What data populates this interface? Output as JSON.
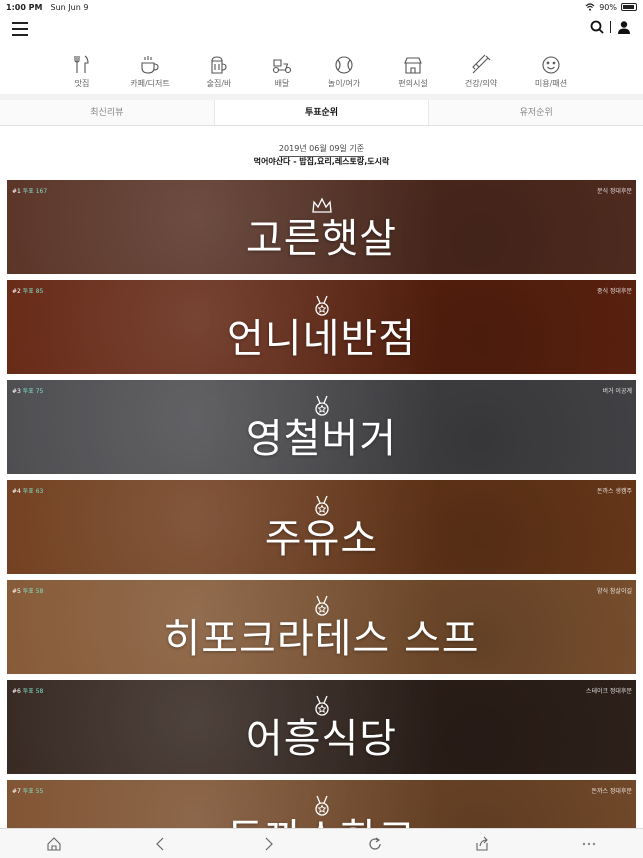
{
  "status": {
    "time": "1:00 PM",
    "date": "Sun Jun 9",
    "battery": "90%",
    "battery_level": 0.9
  },
  "categories": [
    {
      "label": "맛집",
      "icon": "utensils-icon"
    },
    {
      "label": "카페/디저트",
      "icon": "coffee-cup-icon"
    },
    {
      "label": "술집/바",
      "icon": "beer-mug-icon"
    },
    {
      "label": "배달",
      "icon": "delivery-scooter-icon"
    },
    {
      "label": "놀이/여가",
      "icon": "ball-icon"
    },
    {
      "label": "편의시설",
      "icon": "store-icon"
    },
    {
      "label": "건강/의약",
      "icon": "syringe-icon"
    },
    {
      "label": "미용/패션",
      "icon": "smile-face-icon"
    }
  ],
  "tabs": [
    {
      "label": "최신리뷰",
      "active": false
    },
    {
      "label": "투표순위",
      "active": true
    },
    {
      "label": "유저순위",
      "active": false
    }
  ],
  "ranking": {
    "date": "2019년 06월 09일 기준",
    "subtitle": "먹어야산다 - 밥집,요리,레스토랑,도시락",
    "items": [
      {
        "rank": "1",
        "votes": "투표 167",
        "category": "분식 정대후문",
        "name": "고른햇살",
        "medal": "crown-icon",
        "bg": "#6b3a2a"
      },
      {
        "rank": "2",
        "votes": "투표 85",
        "category": "중식 정대후문",
        "name": "언니네반점",
        "medal": "medal-icon",
        "bg": "#7a2d14"
      },
      {
        "rank": "3",
        "votes": "투표 75",
        "category": "버거 이공계",
        "name": "영철버거",
        "medal": "medal-icon",
        "bg": "#5a5a5e"
      },
      {
        "rank": "4",
        "votes": "투표 63",
        "category": "돈까스 생캠주",
        "name": "주유소",
        "medal": "medal-icon",
        "bg": "#8a4a22"
      },
      {
        "rank": "5",
        "votes": "투표 58",
        "category": "양식 참살이길",
        "name": "히포크라테스 스프",
        "medal": "medal-icon",
        "bg": "#a26a3e"
      },
      {
        "rank": "6",
        "votes": "투표 58",
        "category": "스테이크 정대후문",
        "name": "어흥식당",
        "medal": "medal-icon",
        "bg": "#3e2c24"
      },
      {
        "rank": "7",
        "votes": "투표 55",
        "category": "돈까스 정대후문",
        "name": "돈까스학교",
        "medal": "medal-icon",
        "bg": "#9a6238"
      }
    ]
  },
  "bottom_bar": [
    {
      "icon": "home-icon"
    },
    {
      "icon": "back-arrow-icon"
    },
    {
      "icon": "forward-arrow-icon"
    },
    {
      "icon": "reload-icon"
    },
    {
      "icon": "share-icon"
    },
    {
      "icon": "more-dots-icon"
    }
  ]
}
